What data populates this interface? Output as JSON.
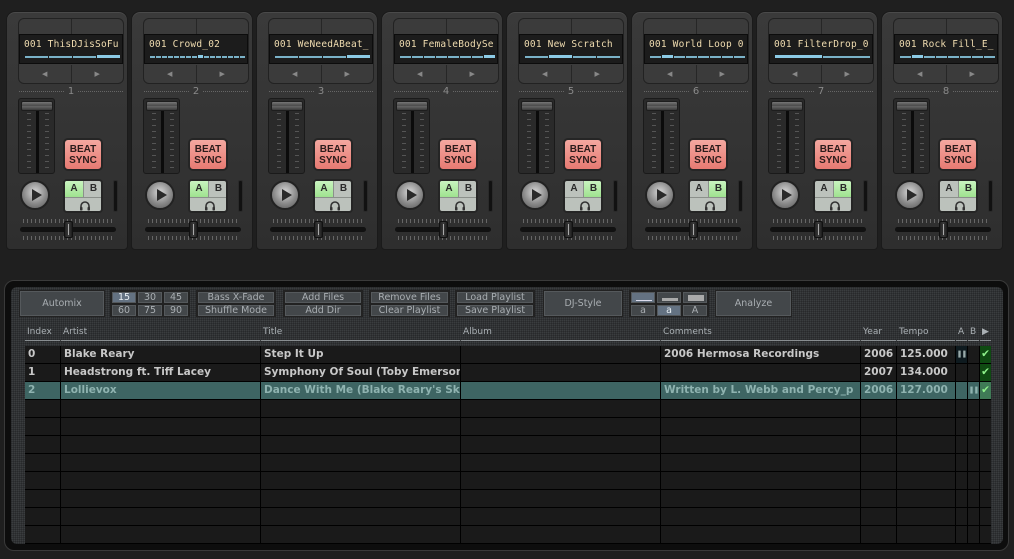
{
  "decks": [
    {
      "number": "1",
      "display_text": "001 ThisDJisSoFu",
      "segments": 4,
      "active_segment": 3,
      "crossfader_side": "A",
      "beat_sync_label": "BEAT SYNC"
    },
    {
      "number": "2",
      "display_text": "001 Crowd_02",
      "segments": 16,
      "active_segment": 8,
      "crossfader_side": "A",
      "beat_sync_label": "BEAT SYNC"
    },
    {
      "number": "3",
      "display_text": "001 WeNeedABeat_",
      "segments": 4,
      "active_segment": 3,
      "crossfader_side": "A",
      "beat_sync_label": "BEAT SYNC"
    },
    {
      "number": "4",
      "display_text": "001 FemaleBodySe",
      "segments": 8,
      "active_segment": 7,
      "crossfader_side": "A",
      "beat_sync_label": "BEAT SYNC"
    },
    {
      "number": "5",
      "display_text": "001 New Scratch",
      "segments": 4,
      "active_segment": 1,
      "crossfader_side": "B",
      "beat_sync_label": "BEAT SYNC"
    },
    {
      "number": "6",
      "display_text": "001 World Loop 0",
      "segments": 8,
      "active_segment": 1,
      "crossfader_side": "B",
      "beat_sync_label": "BEAT SYNC"
    },
    {
      "number": "7",
      "display_text": "001 FilterDrop_0",
      "segments": 2,
      "active_segment": 0,
      "crossfader_side": "B",
      "beat_sync_label": "BEAT SYNC"
    },
    {
      "number": "8",
      "display_text": "001 Rock Fill_E_",
      "segments": 8,
      "active_segment": 1,
      "crossfader_side": "B",
      "beat_sync_label": "BEAT SYNC"
    }
  ],
  "deck_controls": {
    "prev_icon": "◀",
    "next_icon": "▶",
    "a_label": "A",
    "b_label": "B",
    "headphone_icon": "headphones-icon",
    "play_icon": "play-icon"
  },
  "toolbar": {
    "automix": "Automix",
    "durations": [
      "15",
      "30",
      "45",
      "60",
      "75",
      "90"
    ],
    "selected_duration": "15",
    "bass_xfade": "Bass X-Fade",
    "shuffle_mode": "Shuffle Mode",
    "add_files": "Add Files",
    "add_dir": "Add Dir",
    "remove_files": "Remove Files",
    "clear_playlist": "Clear Playlist",
    "load_playlist": "Load Playlist",
    "save_playlist": "Save Playlist",
    "dj_style": "DJ-Style",
    "row_sizes": [
      "small",
      "medium",
      "large"
    ],
    "font_sizes": [
      "a",
      "a",
      "A"
    ],
    "selected_font_size_index": 1,
    "selected_row_size_index": 0,
    "analyze": "Analyze"
  },
  "table": {
    "columns": [
      "Index",
      "Artist",
      "Title",
      "Album",
      "Comments",
      "Year",
      "Tempo",
      "A",
      "B",
      "▶"
    ],
    "rows": [
      {
        "index": "0",
        "artist": "Blake Reary",
        "title": "Step It Up",
        "album": "",
        "comments": "2006 Hermosa Recordings",
        "year": "2006",
        "tempo": "125.000",
        "a": "❚❚",
        "b": "",
        "enabled": true,
        "selected": false
      },
      {
        "index": "1",
        "artist": "Headstrong ft. Tiff Lacey",
        "title": "Symphony Of Soul (Toby Emersons",
        "album": "",
        "comments": "",
        "year": "2007",
        "tempo": "134.000",
        "a": "",
        "b": "",
        "enabled": true,
        "selected": false
      },
      {
        "index": "2",
        "artist": "Lollievox",
        "title": "Dance With Me (Blake Reary's Sky",
        "album": "",
        "comments": "Written by L. Webb and Percy_p",
        "year": "2006",
        "tempo": "127.000",
        "a": "",
        "b": "❚❚",
        "enabled": true,
        "selected": true
      }
    ],
    "empty_rows": 8,
    "check_icon": "✔"
  },
  "colors": {
    "beat_sync": "#e77a72",
    "ab_active": "#9fe28f",
    "display_text": "#f0dcb0",
    "display_bar": "#7ab2c8",
    "selected_row": "#3e6563",
    "enabled_check_bg": "#0f4a12",
    "duration_selected": "#647282"
  }
}
